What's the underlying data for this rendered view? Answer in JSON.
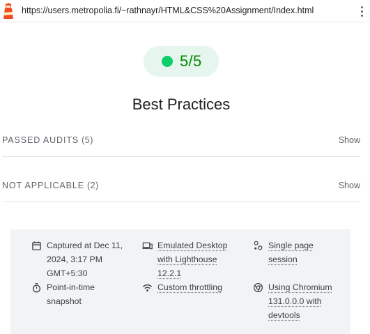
{
  "header": {
    "url": "https://users.metropolia.fi/~rathnayr/HTML&CSS%20Assignment/Index.html",
    "logo_icon": "lighthouse-logo-icon",
    "menu_icon": "kebab-menu-icon"
  },
  "score": {
    "value": "5/5",
    "fraction": 1.0,
    "color": "#0cce6b",
    "text_color": "#008800",
    "pill_bg": "#e6f6ee"
  },
  "category": {
    "title": "Best Practices"
  },
  "groups": [
    {
      "title": "Passed audits",
      "count": "(5)",
      "action": "Show"
    },
    {
      "title": "Not applicable",
      "count": "(2)",
      "action": "Show"
    }
  ],
  "runtime": {
    "captured": {
      "icon": "calendar-icon",
      "lines": [
        "Captured at Dec 11,",
        "2024, 3:17 PM",
        "GMT+5:30"
      ]
    },
    "emulation": {
      "icon": "devices-icon",
      "lines": [
        "Emulated Desktop",
        "with Lighthouse",
        "12.2.1"
      ]
    },
    "session": {
      "icon": "session-icon",
      "lines": [
        "Single page",
        "session"
      ]
    },
    "snapshot": {
      "icon": "stopwatch-icon",
      "lines": [
        "Point-in-time",
        "snapshot"
      ]
    },
    "throttling": {
      "icon": "wifi-icon",
      "lines": [
        "Custom throttling"
      ]
    },
    "chromium": {
      "icon": "chrome-icon",
      "lines": [
        "Using Chromium",
        "131.0.0.0 with",
        "devtools"
      ]
    }
  }
}
